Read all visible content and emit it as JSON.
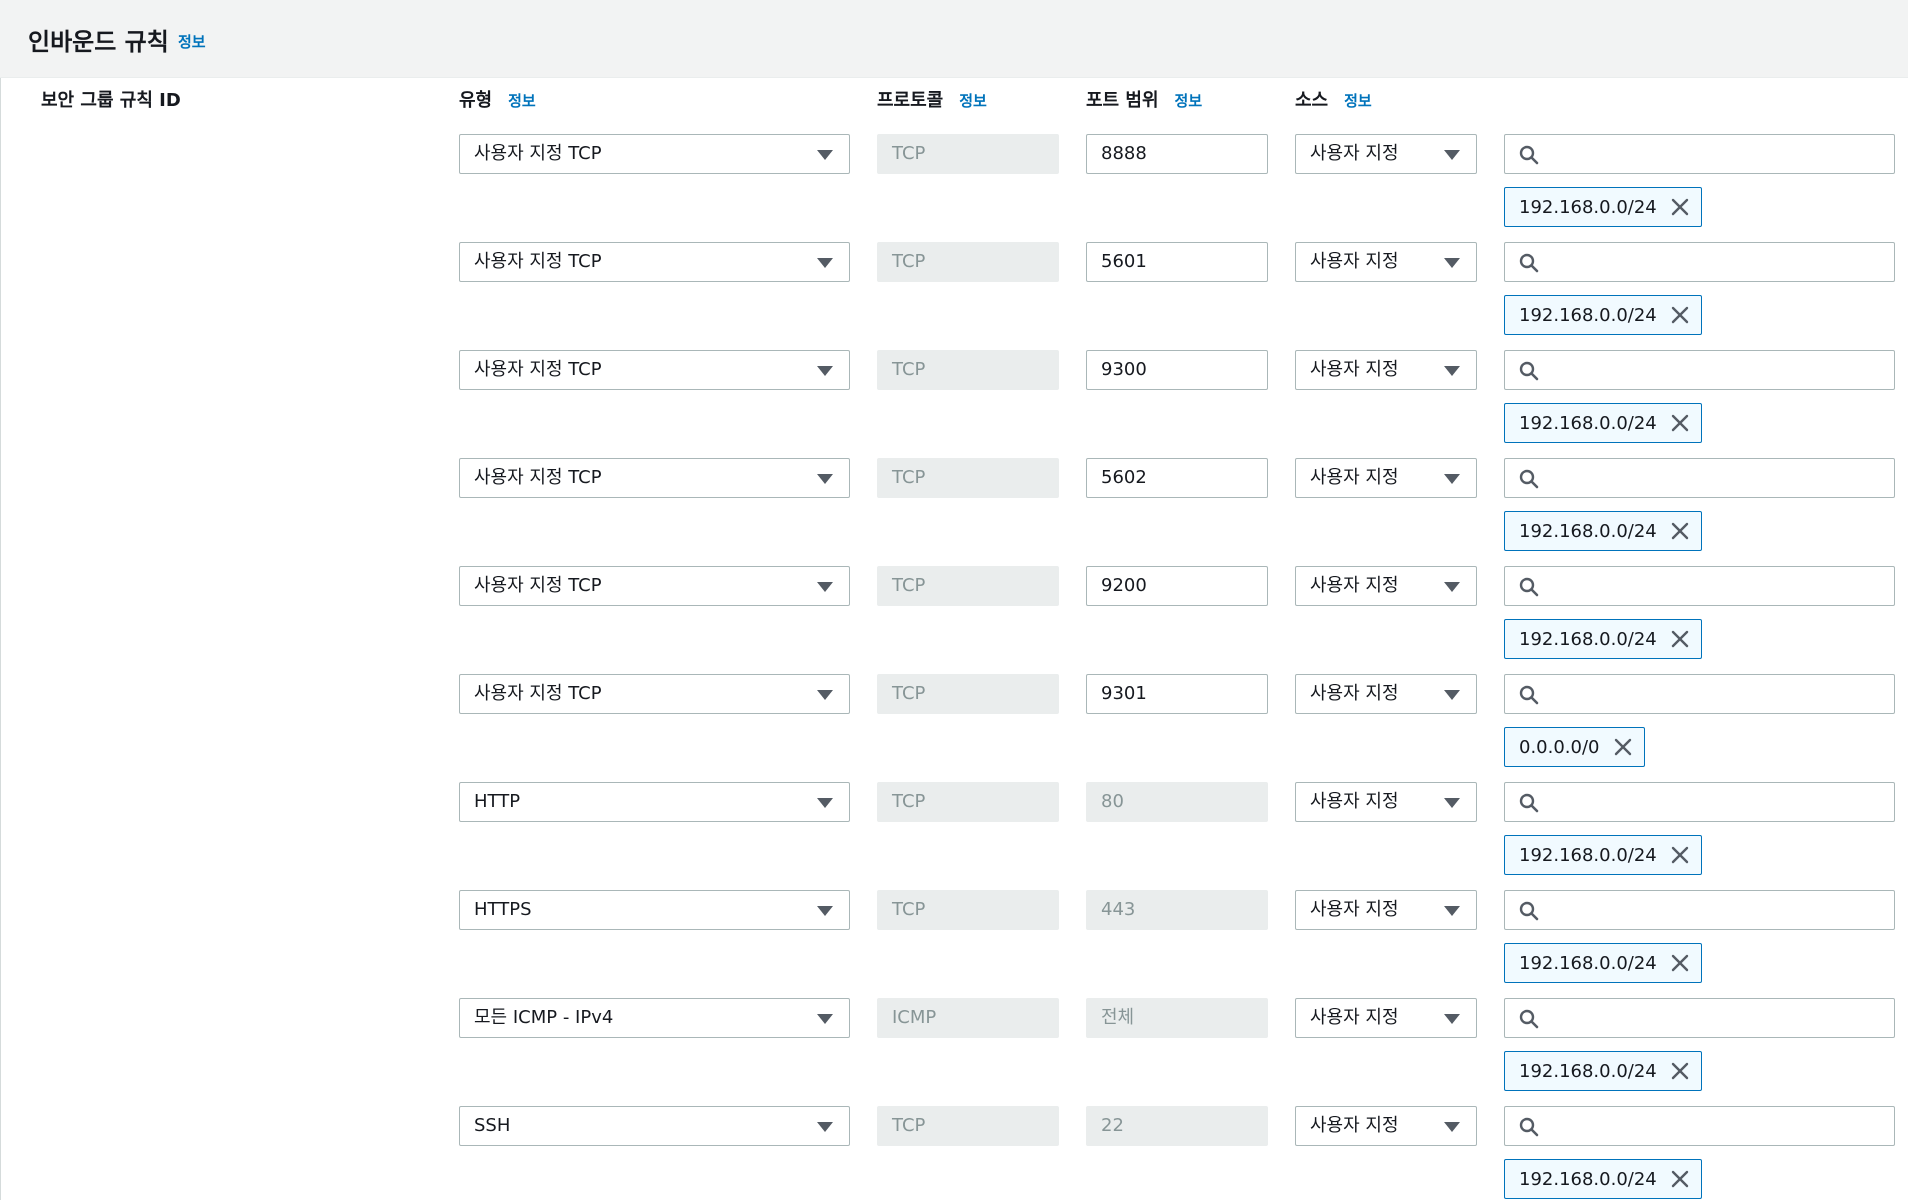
{
  "header": {
    "title": "인바운드 규칙",
    "info": "정보"
  },
  "columns": {
    "rule_id": "보안 그룹 규칙 ID",
    "type": "유형",
    "protocol": "프로토콜",
    "port_range": "포트 범위",
    "source": "소스",
    "info": "정보"
  },
  "rules": [
    {
      "type": "사용자 지정 TCP",
      "protocol": "TCP",
      "port": "8888",
      "port_editable": true,
      "source": "사용자 지정",
      "cidr": "192.168.0.0/24"
    },
    {
      "type": "사용자 지정 TCP",
      "protocol": "TCP",
      "port": "5601",
      "port_editable": true,
      "source": "사용자 지정",
      "cidr": "192.168.0.0/24"
    },
    {
      "type": "사용자 지정 TCP",
      "protocol": "TCP",
      "port": "9300",
      "port_editable": true,
      "source": "사용자 지정",
      "cidr": "192.168.0.0/24"
    },
    {
      "type": "사용자 지정 TCP",
      "protocol": "TCP",
      "port": "5602",
      "port_editable": true,
      "source": "사용자 지정",
      "cidr": "192.168.0.0/24"
    },
    {
      "type": "사용자 지정 TCP",
      "protocol": "TCP",
      "port": "9200",
      "port_editable": true,
      "source": "사용자 지정",
      "cidr": "192.168.0.0/24"
    },
    {
      "type": "사용자 지정 TCP",
      "protocol": "TCP",
      "port": "9301",
      "port_editable": true,
      "source": "사용자 지정",
      "cidr": "0.0.0.0/0"
    },
    {
      "type": "HTTP",
      "protocol": "TCP",
      "port": "80",
      "port_editable": false,
      "source": "사용자 지정",
      "cidr": "192.168.0.0/24"
    },
    {
      "type": "HTTPS",
      "protocol": "TCP",
      "port": "443",
      "port_editable": false,
      "source": "사용자 지정",
      "cidr": "192.168.0.0/24"
    },
    {
      "type": "모든 ICMP - IPv4",
      "protocol": "ICMP",
      "port": "전체",
      "port_editable": false,
      "source": "사용자 지정",
      "cidr": "192.168.0.0/24"
    },
    {
      "type": "SSH",
      "protocol": "TCP",
      "port": "22",
      "port_editable": false,
      "source": "사용자 지정",
      "cidr": "192.168.0.0/24"
    }
  ],
  "icons": {
    "dropdown": "caret-down-icon",
    "search": "search-icon",
    "remove": "close-icon"
  },
  "colors": {
    "link": "#0073bb",
    "token_bg": "#f1faff",
    "disabled_bg": "#eaeded"
  }
}
